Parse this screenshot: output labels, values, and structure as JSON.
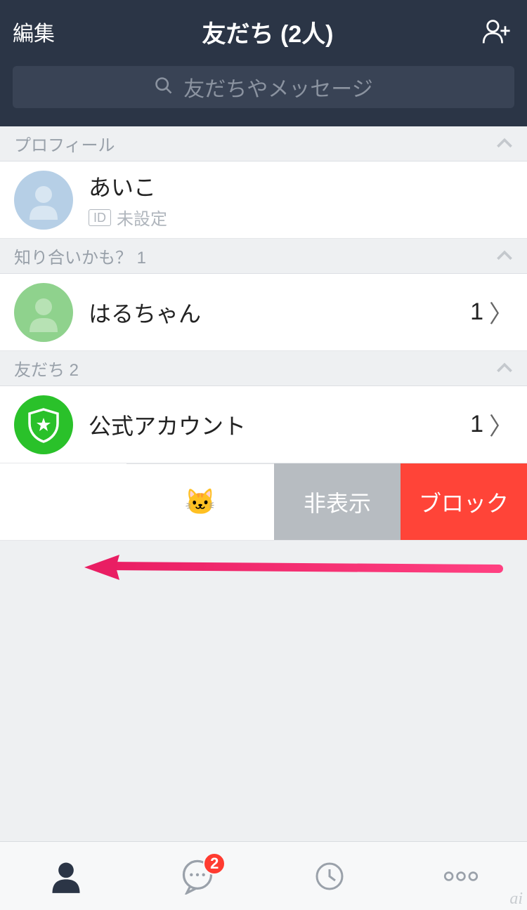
{
  "header": {
    "edit_label": "編集",
    "title": "友だち (2人)"
  },
  "search": {
    "placeholder": "友だちやメッセージ"
  },
  "sections": {
    "profile": {
      "header": "プロフィール",
      "name": "あいこ",
      "id_badge": "ID",
      "id_status": "未設定"
    },
    "suggestions": {
      "header": "知り合いかも？ 1",
      "name": "はるちゃん",
      "count": "1"
    },
    "friends": {
      "header": "友だち 2",
      "official": {
        "name": "公式アカウント",
        "count": "1"
      },
      "swiped_row": {
        "emoji": "🐱",
        "hide_label": "非表示",
        "block_label": "ブロック"
      }
    }
  },
  "tabbar": {
    "chat_badge": "2"
  },
  "watermark": "ai"
}
